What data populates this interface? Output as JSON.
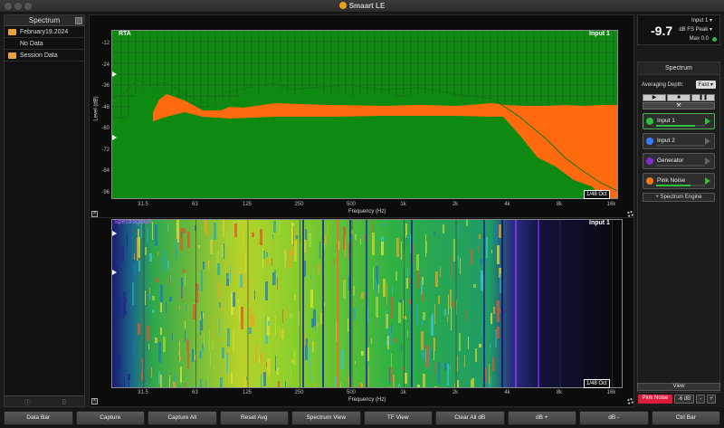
{
  "window": {
    "title": "Smaart LE"
  },
  "left_panel": {
    "title": "Spectrum",
    "items": [
      {
        "label": "February19.2024",
        "type": "folder"
      },
      {
        "label": "No Data",
        "type": "child"
      },
      {
        "label": "Session Data",
        "type": "folder"
      }
    ]
  },
  "rta": {
    "label": "RTA",
    "input_label": "Input 1",
    "y_title": "Level (dB)",
    "x_title": "Frequency (Hz)",
    "oct_badge": "1/48 Oct",
    "y_ticks": [
      "-12",
      "-24",
      "-36",
      "-48",
      "-60",
      "-72",
      "-84",
      "-96"
    ],
    "x_ticks": [
      "31.5",
      "63",
      "125",
      "250",
      "500",
      "1k",
      "2k",
      "4k",
      "8k",
      "16k"
    ]
  },
  "spectrograph": {
    "label": "Spectrograph",
    "input_label": "Input 1",
    "x_title": "Frequency (Hz)",
    "oct_badge": "1/48 Oct",
    "x_ticks": [
      "31.5",
      "63",
      "125",
      "250",
      "500",
      "1k",
      "2k",
      "4k",
      "8k",
      "16k"
    ]
  },
  "meter": {
    "value": "-9.7",
    "input": "Input 1",
    "mode": "dB FS Peak",
    "max": "Max 0.0"
  },
  "spectrum_panel": {
    "title": "Spectrum",
    "averaging_label": "Averaging Depth:",
    "averaging_value": "Fast",
    "engine_button": "+ Spectrum Engine",
    "channels": [
      {
        "label": "Input 1",
        "color": "#2fbf3a",
        "active": true
      },
      {
        "label": "Input 2",
        "color": "#3b7bff",
        "active": false
      },
      {
        "label": "Generator",
        "color": "#7a2fd0",
        "active": false
      },
      {
        "label": "Pink Noise",
        "color": "#f07a18",
        "active": false
      }
    ]
  },
  "view_button": "View",
  "generator_row": {
    "name": "Pink Noise",
    "level": "-6 dB",
    "minus": "-",
    "plus": "+"
  },
  "bottom_bar": [
    "Data Bar",
    "Capture",
    "Capture All",
    "Reset Avg",
    "Spectrum View",
    "TF View",
    "Clear All dB",
    "dB +",
    "dB -",
    "Ctrl Bar"
  ]
}
